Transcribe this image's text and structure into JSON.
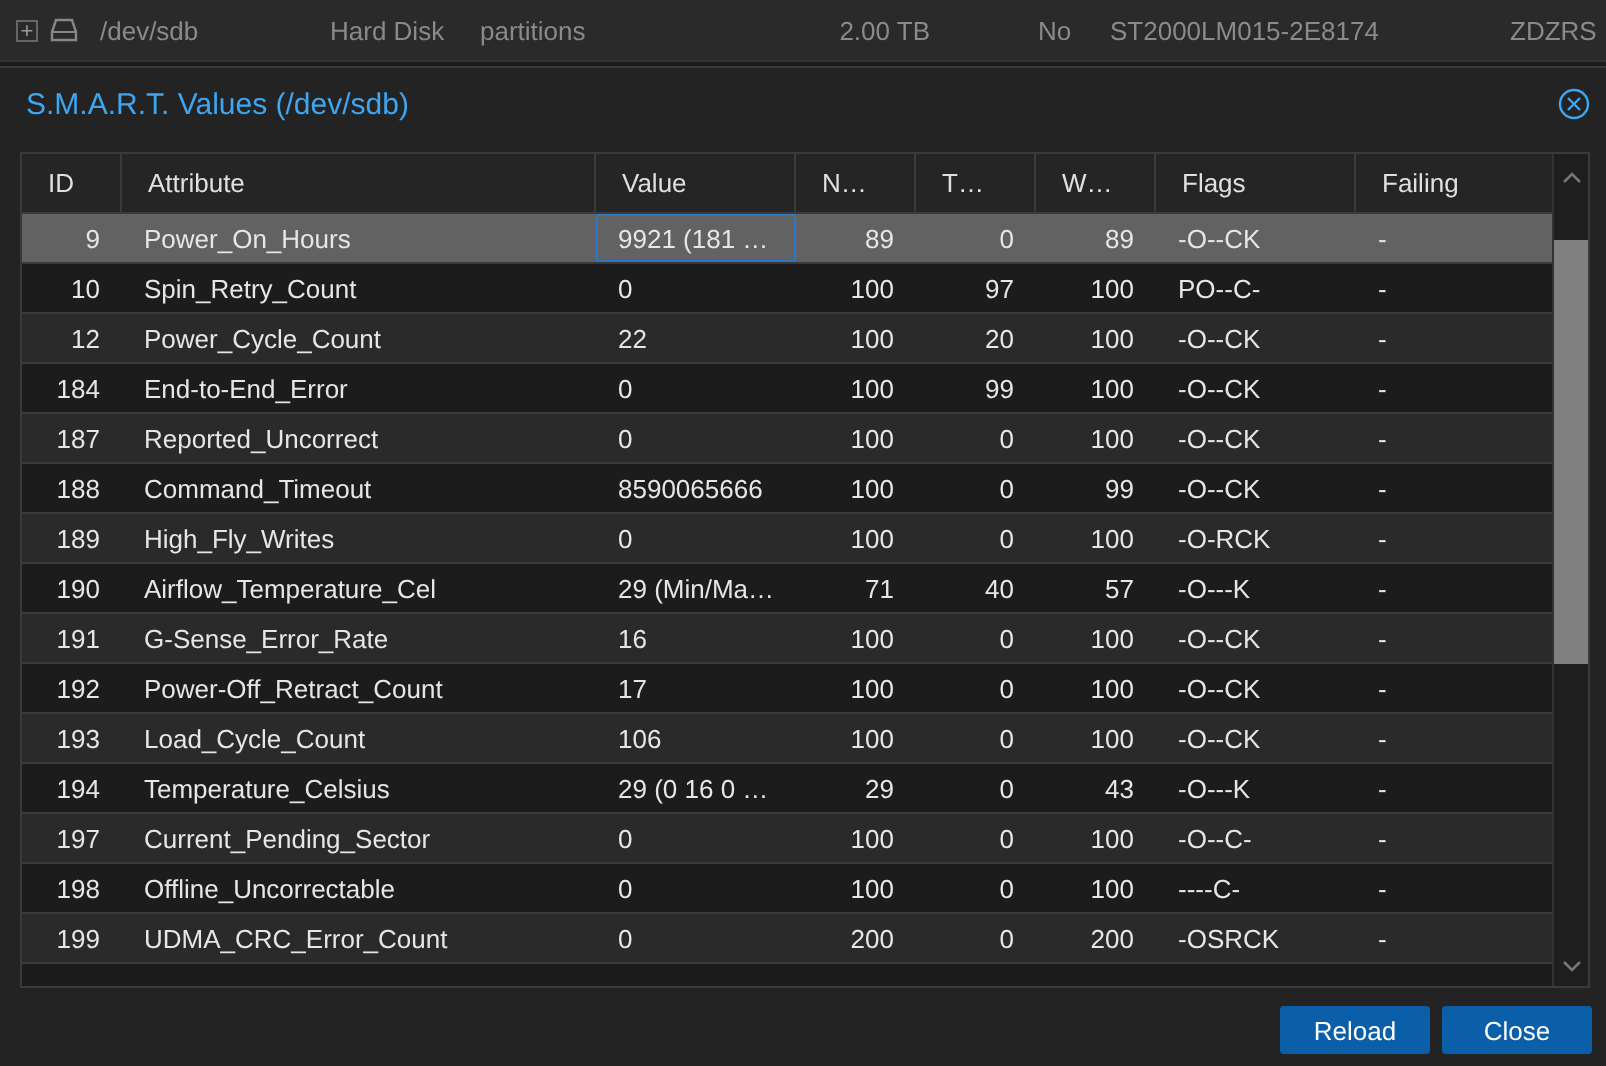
{
  "background_row": {
    "expand": "+",
    "device": "/dev/sdb",
    "type": "Hard Disk",
    "usage": "partitions",
    "size": "2.00 TB",
    "gpt": "No",
    "model": "ST2000LM015-2E8174",
    "serial": "ZDZRS"
  },
  "dialog": {
    "title": "S.M.A.R.T. Values (/dev/sdb)",
    "columns": [
      "ID",
      "Attribute",
      "Value",
      "N…",
      "T…",
      "W…",
      "Flags",
      "Failing"
    ],
    "rows": [
      {
        "cells": [
          "9",
          "Power_On_Hours",
          "9921 (181 …",
          "89",
          "0",
          "89",
          "-O--CK",
          "-"
        ],
        "selected": true
      },
      {
        "cells": [
          "10",
          "Spin_Retry_Count",
          "0",
          "100",
          "97",
          "100",
          "PO--C-",
          "-"
        ],
        "selected": false
      },
      {
        "cells": [
          "12",
          "Power_Cycle_Count",
          "22",
          "100",
          "20",
          "100",
          "-O--CK",
          "-"
        ],
        "selected": false
      },
      {
        "cells": [
          "184",
          "End-to-End_Error",
          "0",
          "100",
          "99",
          "100",
          "-O--CK",
          "-"
        ],
        "selected": false
      },
      {
        "cells": [
          "187",
          "Reported_Uncorrect",
          "0",
          "100",
          "0",
          "100",
          "-O--CK",
          "-"
        ],
        "selected": false
      },
      {
        "cells": [
          "188",
          "Command_Timeout",
          "8590065666",
          "100",
          "0",
          "99",
          "-O--CK",
          "-"
        ],
        "selected": false
      },
      {
        "cells": [
          "189",
          "High_Fly_Writes",
          "0",
          "100",
          "0",
          "100",
          "-O-RCK",
          "-"
        ],
        "selected": false
      },
      {
        "cells": [
          "190",
          "Airflow_Temperature_Cel",
          "29 (Min/Ma…",
          "71",
          "40",
          "57",
          "-O---K",
          "-"
        ],
        "selected": false
      },
      {
        "cells": [
          "191",
          "G-Sense_Error_Rate",
          "16",
          "100",
          "0",
          "100",
          "-O--CK",
          "-"
        ],
        "selected": false
      },
      {
        "cells": [
          "192",
          "Power-Off_Retract_Count",
          "17",
          "100",
          "0",
          "100",
          "-O--CK",
          "-"
        ],
        "selected": false
      },
      {
        "cells": [
          "193",
          "Load_Cycle_Count",
          "106",
          "100",
          "0",
          "100",
          "-O--CK",
          "-"
        ],
        "selected": false
      },
      {
        "cells": [
          "194",
          "Temperature_Celsius",
          "29 (0 16 0 …",
          "29",
          "0",
          "43",
          "-O---K",
          "-"
        ],
        "selected": false
      },
      {
        "cells": [
          "197",
          "Current_Pending_Sector",
          "0",
          "100",
          "0",
          "100",
          "-O--C-",
          "-"
        ],
        "selected": false
      },
      {
        "cells": [
          "198",
          "Offline_Uncorrectable",
          "0",
          "100",
          "0",
          "100",
          "----C-",
          "-"
        ],
        "selected": false
      },
      {
        "cells": [
          "199",
          "UDMA_CRC_Error_Count",
          "0",
          "200",
          "0",
          "200",
          "-OSRCK",
          "-"
        ],
        "selected": false
      }
    ],
    "buttons": [
      "Reload",
      "Close"
    ]
  }
}
